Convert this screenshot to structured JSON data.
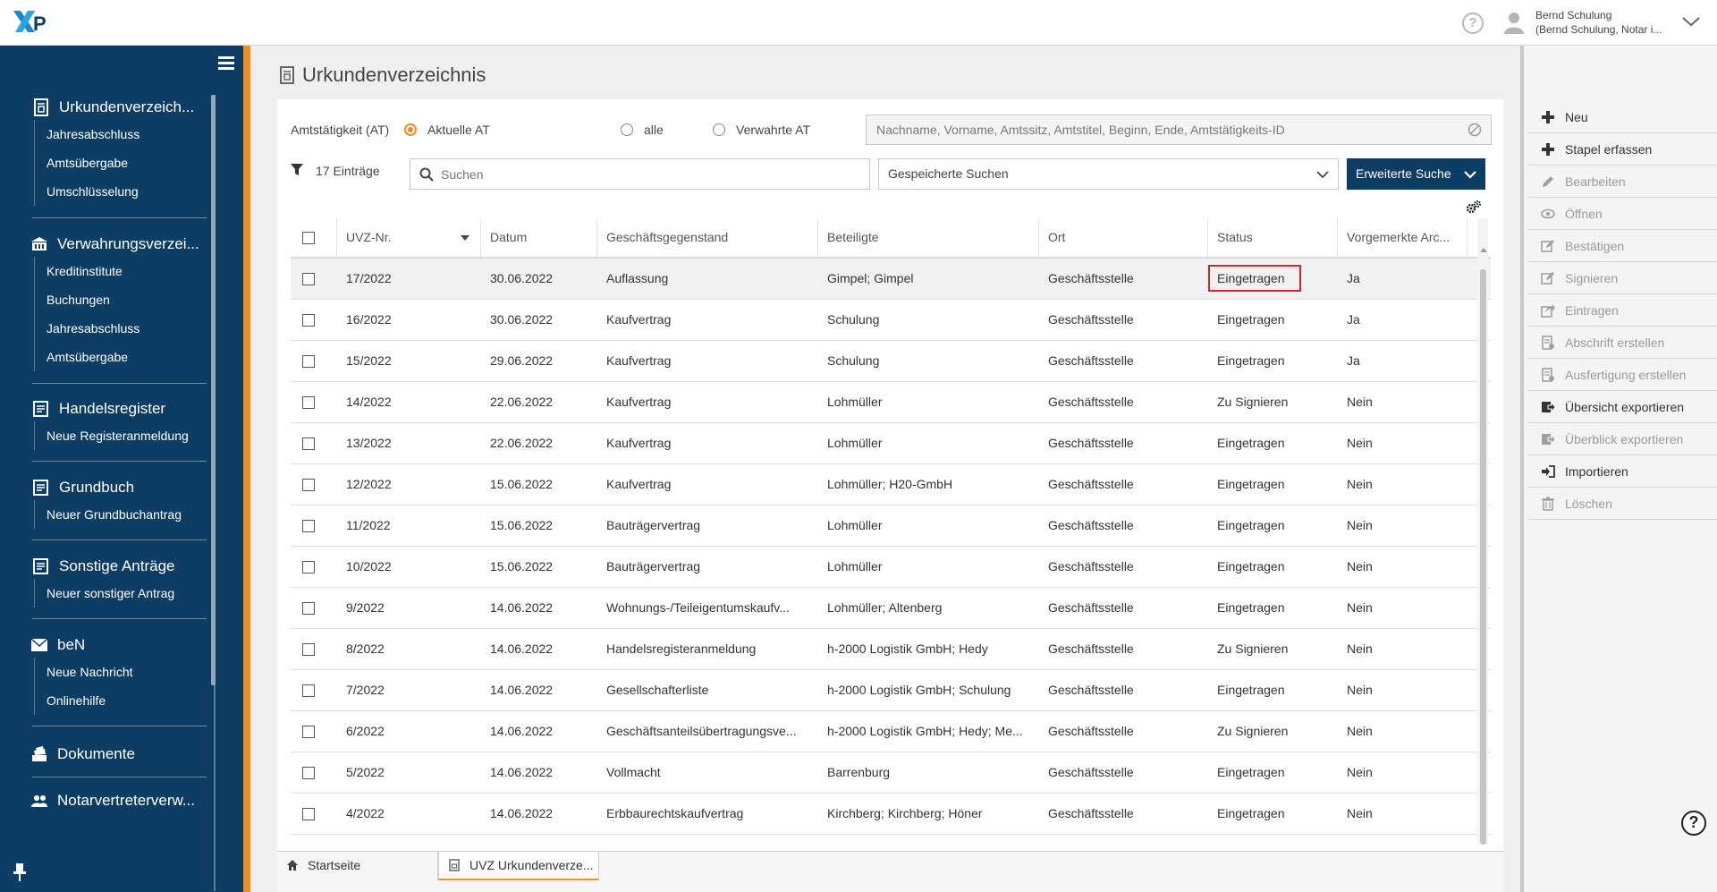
{
  "user": {
    "name": "Bernd Schulung",
    "role": "(Bernd Schulung, Notar i..."
  },
  "sidebar": {
    "sections": [
      {
        "label": "Urkundenverzeich...",
        "items": [
          "Jahresabschluss",
          "Amtsübergabe",
          "Umschlüsselung"
        ]
      },
      {
        "label": "Verwahrungsverzei...",
        "items": [
          "Kreditinstitute",
          "Buchungen",
          "Jahresabschluss",
          "Amtsübergabe"
        ]
      },
      {
        "label": "Handelsregister",
        "items": [
          "Neue Registeranmeldung"
        ]
      },
      {
        "label": "Grundbuch",
        "items": [
          "Neuer Grundbuchantrag"
        ]
      },
      {
        "label": "Sonstige Anträge",
        "items": [
          "Neuer sonstiger Antrag"
        ]
      },
      {
        "label": "beN",
        "items": [
          "Neue Nachricht",
          "Onlinehilfe"
        ]
      },
      {
        "label": "Dokumente",
        "items": []
      },
      {
        "label": "Notarvertreterverw...",
        "items": []
      }
    ]
  },
  "page": {
    "title": "Urkundenverzeichnis"
  },
  "filters": {
    "at_label": "Amtstätigkeit (AT)",
    "radios": [
      {
        "label": "Aktuelle AT",
        "checked": true
      },
      {
        "label": "alle",
        "checked": false
      },
      {
        "label": "Verwahrte AT",
        "checked": false
      }
    ],
    "at_search_placeholder": "Nachname, Vorname, Amtssitz, Amtstitel, Beginn, Ende, Amtstätigkeits-ID",
    "count": "17 Einträge",
    "search_placeholder": "Suchen",
    "saved_searches": "Gespeicherte Suchen",
    "advanced_search": "Erweiterte Suche"
  },
  "table": {
    "columns": [
      "UVZ-Nr.",
      "Datum",
      "Geschäftsgegenstand",
      "Beteiligte",
      "Ort",
      "Status",
      "Vorgemerkte Arc..."
    ],
    "rows": [
      [
        "17/2022",
        "30.06.2022",
        "Auflassung",
        "Gimpel; Gimpel",
        "Geschäftsstelle",
        "Eingetragen",
        "Ja"
      ],
      [
        "16/2022",
        "30.06.2022",
        "Kaufvertrag",
        "Schulung",
        "Geschäftsstelle",
        "Eingetragen",
        "Ja"
      ],
      [
        "15/2022",
        "29.06.2022",
        "Kaufvertrag",
        "Schulung",
        "Geschäftsstelle",
        "Eingetragen",
        "Ja"
      ],
      [
        "14/2022",
        "22.06.2022",
        "Kaufvertrag",
        "Lohmüller",
        "Geschäftsstelle",
        "Zu Signieren",
        "Nein"
      ],
      [
        "13/2022",
        "22.06.2022",
        "Kaufvertrag",
        "Lohmüller",
        "Geschäftsstelle",
        "Eingetragen",
        "Nein"
      ],
      [
        "12/2022",
        "15.06.2022",
        "Kaufvertrag",
        "Lohmüller; H20-GmbH",
        "Geschäftsstelle",
        "Eingetragen",
        "Nein"
      ],
      [
        "11/2022",
        "15.06.2022",
        "Bauträgervertrag",
        "Lohmüller",
        "Geschäftsstelle",
        "Eingetragen",
        "Nein"
      ],
      [
        "10/2022",
        "15.06.2022",
        "Bauträgervertrag",
        "Lohmüller",
        "Geschäftsstelle",
        "Eingetragen",
        "Nein"
      ],
      [
        "9/2022",
        "14.06.2022",
        "Wohnungs-/Teileigentumskaufv...",
        "Lohmüller; Altenberg",
        "Geschäftsstelle",
        "Eingetragen",
        "Nein"
      ],
      [
        "8/2022",
        "14.06.2022",
        "Handelsregisteranmeldung",
        "h-2000 Logistik GmbH; Hedy",
        "Geschäftsstelle",
        "Zu Signieren",
        "Nein"
      ],
      [
        "7/2022",
        "14.06.2022",
        "Gesellschafterliste",
        "h-2000 Logistik GmbH; Schulung",
        "Geschäftsstelle",
        "Eingetragen",
        "Nein"
      ],
      [
        "6/2022",
        "14.06.2022",
        "Geschäftsanteilsübertragungsve...",
        "h-2000 Logistik GmbH; Hedy; Me...",
        "Geschäftsstelle",
        "Zu Signieren",
        "Nein"
      ],
      [
        "5/2022",
        "14.06.2022",
        "Vollmacht",
        "Barrenburg",
        "Geschäftsstelle",
        "Eingetragen",
        "Nein"
      ],
      [
        "4/2022",
        "14.06.2022",
        "Erbbaurechtskaufvertrag",
        "Kirchberg; Kirchberg; Höner",
        "Geschäftsstelle",
        "Eingetragen",
        "Nein"
      ]
    ]
  },
  "tabs": [
    "Startseite",
    "UVZ Urkundenverze..."
  ],
  "actions": [
    {
      "label": "Neu",
      "icon": "plus-icon",
      "enabled": true
    },
    {
      "label": "Stapel erfassen",
      "icon": "plus-icon",
      "enabled": true
    },
    {
      "label": "Bearbeiten",
      "icon": "pencil-icon",
      "enabled": false
    },
    {
      "label": "Öffnen",
      "icon": "eye-icon",
      "enabled": false
    },
    {
      "label": "Bestätigen",
      "icon": "edit-box-icon",
      "enabled": false
    },
    {
      "label": "Signieren",
      "icon": "edit-box-icon",
      "enabled": false
    },
    {
      "label": "Eintragen",
      "icon": "share-icon",
      "enabled": false
    },
    {
      "label": "Abschrift erstellen",
      "icon": "document-icon",
      "enabled": false
    },
    {
      "label": "Ausfertigung erstellen",
      "icon": "document-icon",
      "enabled": false
    },
    {
      "label": "Übersicht exportieren",
      "icon": "export-icon",
      "enabled": true
    },
    {
      "label": "Überblick exportieren",
      "icon": "export-icon",
      "enabled": false
    },
    {
      "label": "Importieren",
      "icon": "import-icon",
      "enabled": true
    },
    {
      "label": "Löschen",
      "icon": "trash-icon",
      "enabled": false
    }
  ],
  "colors": {
    "sidebar": "#0d3d63",
    "accent": "#f28c1e",
    "highlight_border": "#d1232a"
  }
}
